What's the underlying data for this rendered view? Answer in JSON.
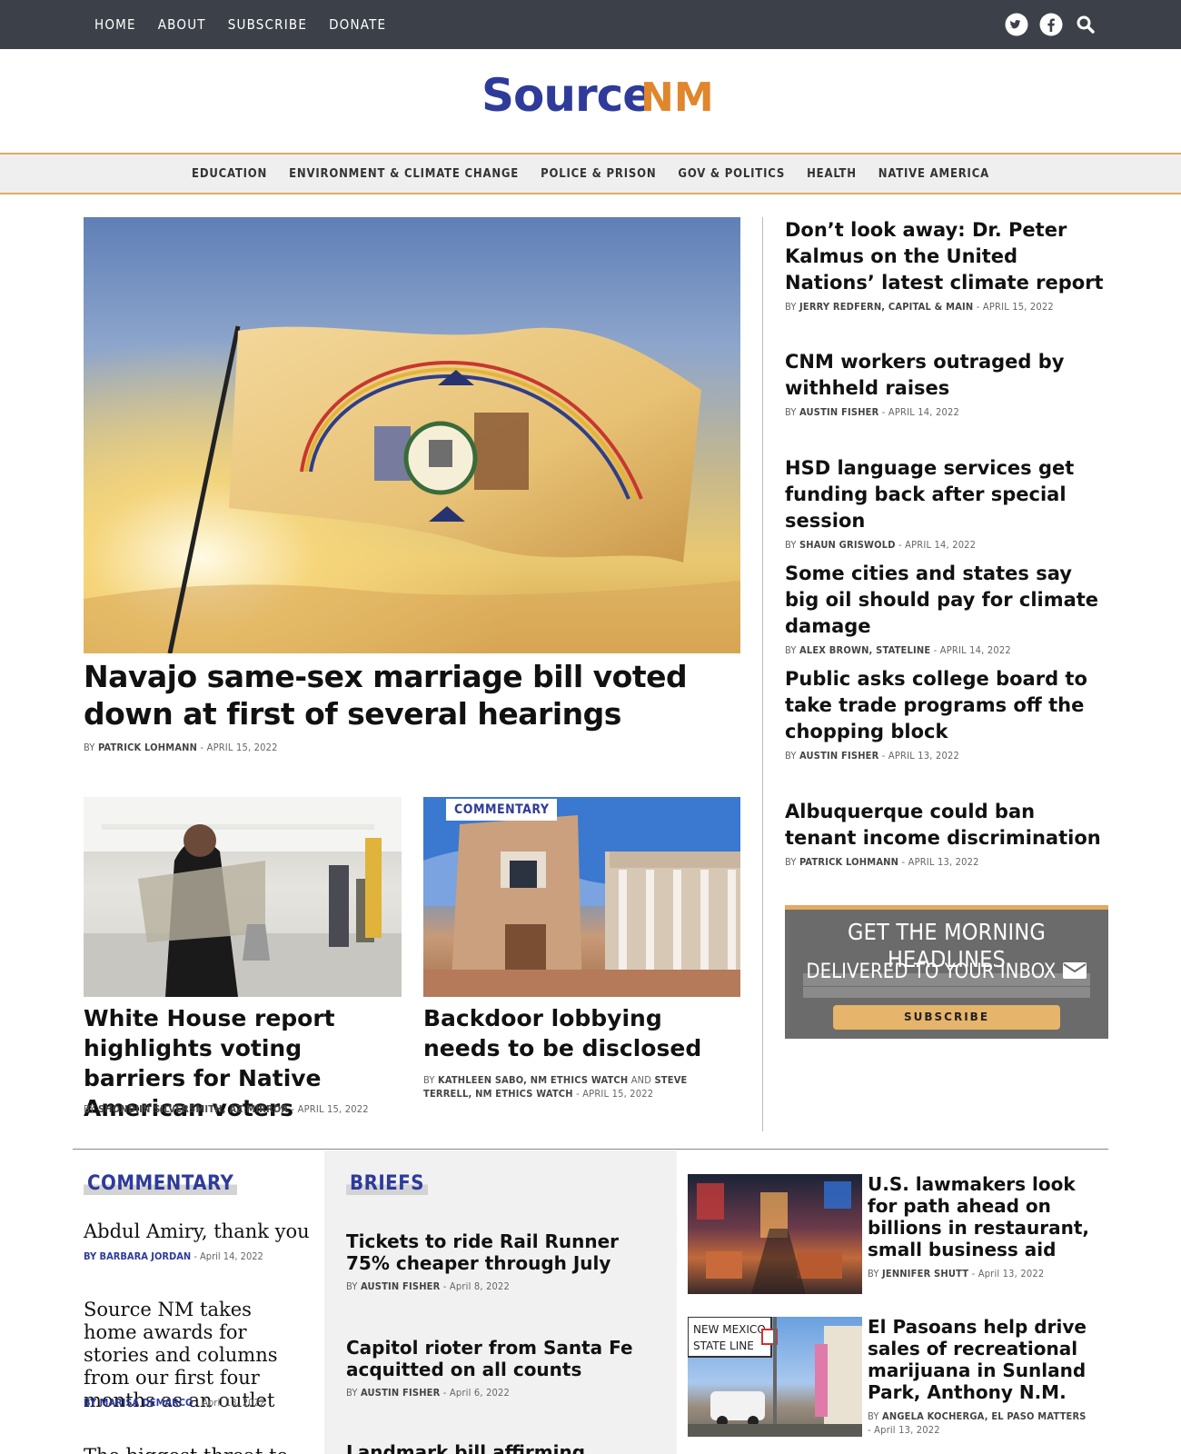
{
  "topnav": [
    "Home",
    "About",
    "Subscribe",
    "Donate"
  ],
  "icons": [
    "twitter-icon",
    "facebook-icon",
    "search-icon"
  ],
  "logo": {
    "source": "Source",
    "nm": "NM"
  },
  "sections": [
    "Education",
    "Environment & Climate Change",
    "Police & Prison",
    "Gov & Politics",
    "Health",
    "Native America"
  ],
  "hero": {
    "title": "Navajo same-sex marriage bill voted down at first of several hearings",
    "by": "BY",
    "author": "PATRICK LOHMANN",
    "date": " - APRIL 15, 2022"
  },
  "card1": {
    "title": "White House report highlights voting barriers for Native American voters",
    "by": "BY",
    "author": "SHONDIIN SILVERSMITH, AZ MIRROR",
    "date": " - APRIL 15, 2022"
  },
  "card2": {
    "tag": "COMMENTARY",
    "title": "Backdoor lobbying needs to be disclosed",
    "by": "BY",
    "author1": "KATHLEEN SABO, NM ETHICS WATCH",
    "and": " AND ",
    "author2": "STEVE TERRELL, NM ETHICS WATCH",
    "date": " - APRIL 15, 2022"
  },
  "side": [
    {
      "title": "Don’t look away: Dr. Peter Kalmus on the United Nations’ latest climate report",
      "author": "JERRY REDFERN, CAPITAL & MAIN",
      "date": " - APRIL 15, 2022"
    },
    {
      "title": "CNM workers outraged by withheld raises",
      "author": "AUSTIN FISHER",
      "date": " - APRIL 14, 2022"
    },
    {
      "title": "HSD language services get funding back after special session",
      "author": "SHAUN GRISWOLD",
      "date": " - APRIL 14, 2022"
    },
    {
      "title": "Some cities and states say big oil should pay for climate damage",
      "author": "ALEX BROWN, STATELINE",
      "date": " - APRIL 14, 2022"
    },
    {
      "title": "Public asks college board to take trade programs off the chopping block",
      "author": "AUSTIN FISHER",
      "date": " - APRIL 13, 2022"
    },
    {
      "title": "Albuquerque could ban tenant income discrimination",
      "author": "PATRICK LOHMANN",
      "date": " - APRIL 13, 2022"
    }
  ],
  "by": "BY",
  "newsletter": {
    "line1": "GET THE MORNING HEADLINES",
    "line2": "DELIVERED TO YOUR INBOX",
    "button": "SUBSCRIBE"
  },
  "commentary": {
    "heading": "COMMENTARY",
    "items": [
      {
        "title": "Abdul Amiry, thank you",
        "author": "BY BARBARA JORDAN",
        "date": " - April 14, 2022"
      },
      {
        "title": "Source NM takes home awards for stories and columns from our first four months as an outlet",
        "author": "BY MARISA DEMARCO",
        "date": " - April 13, 2022"
      }
    ],
    "partial": "The biggest threat to"
  },
  "briefs": {
    "heading": "BRIEFS",
    "items": [
      {
        "title": "Tickets to ride Rail Runner 75% cheaper through July",
        "author": "AUSTIN FISHER",
        "date": " - April 8, 2022"
      },
      {
        "title": "Capitol rioter from Santa Fe acquitted on all counts",
        "author": "AUSTIN FISHER",
        "date": " - April 6, 2022"
      }
    ],
    "partial": "Landmark bill affirming abortion"
  },
  "right": [
    {
      "title": "U.S. lawmakers look for path ahead on billions in restaurant, small business aid",
      "author": "JENNIFER SHUTT",
      "date": " - April 13, 2022"
    },
    {
      "title": "El Pasoans help drive sales of recreational marijuana in Sunland Park, Anthony N.M.",
      "author": "ANGELA KOCHERGA, EL PASO MATTERS",
      "date": "- April 13, 2022",
      "sign": "NEW MEXICO STATE LINE"
    }
  ]
}
